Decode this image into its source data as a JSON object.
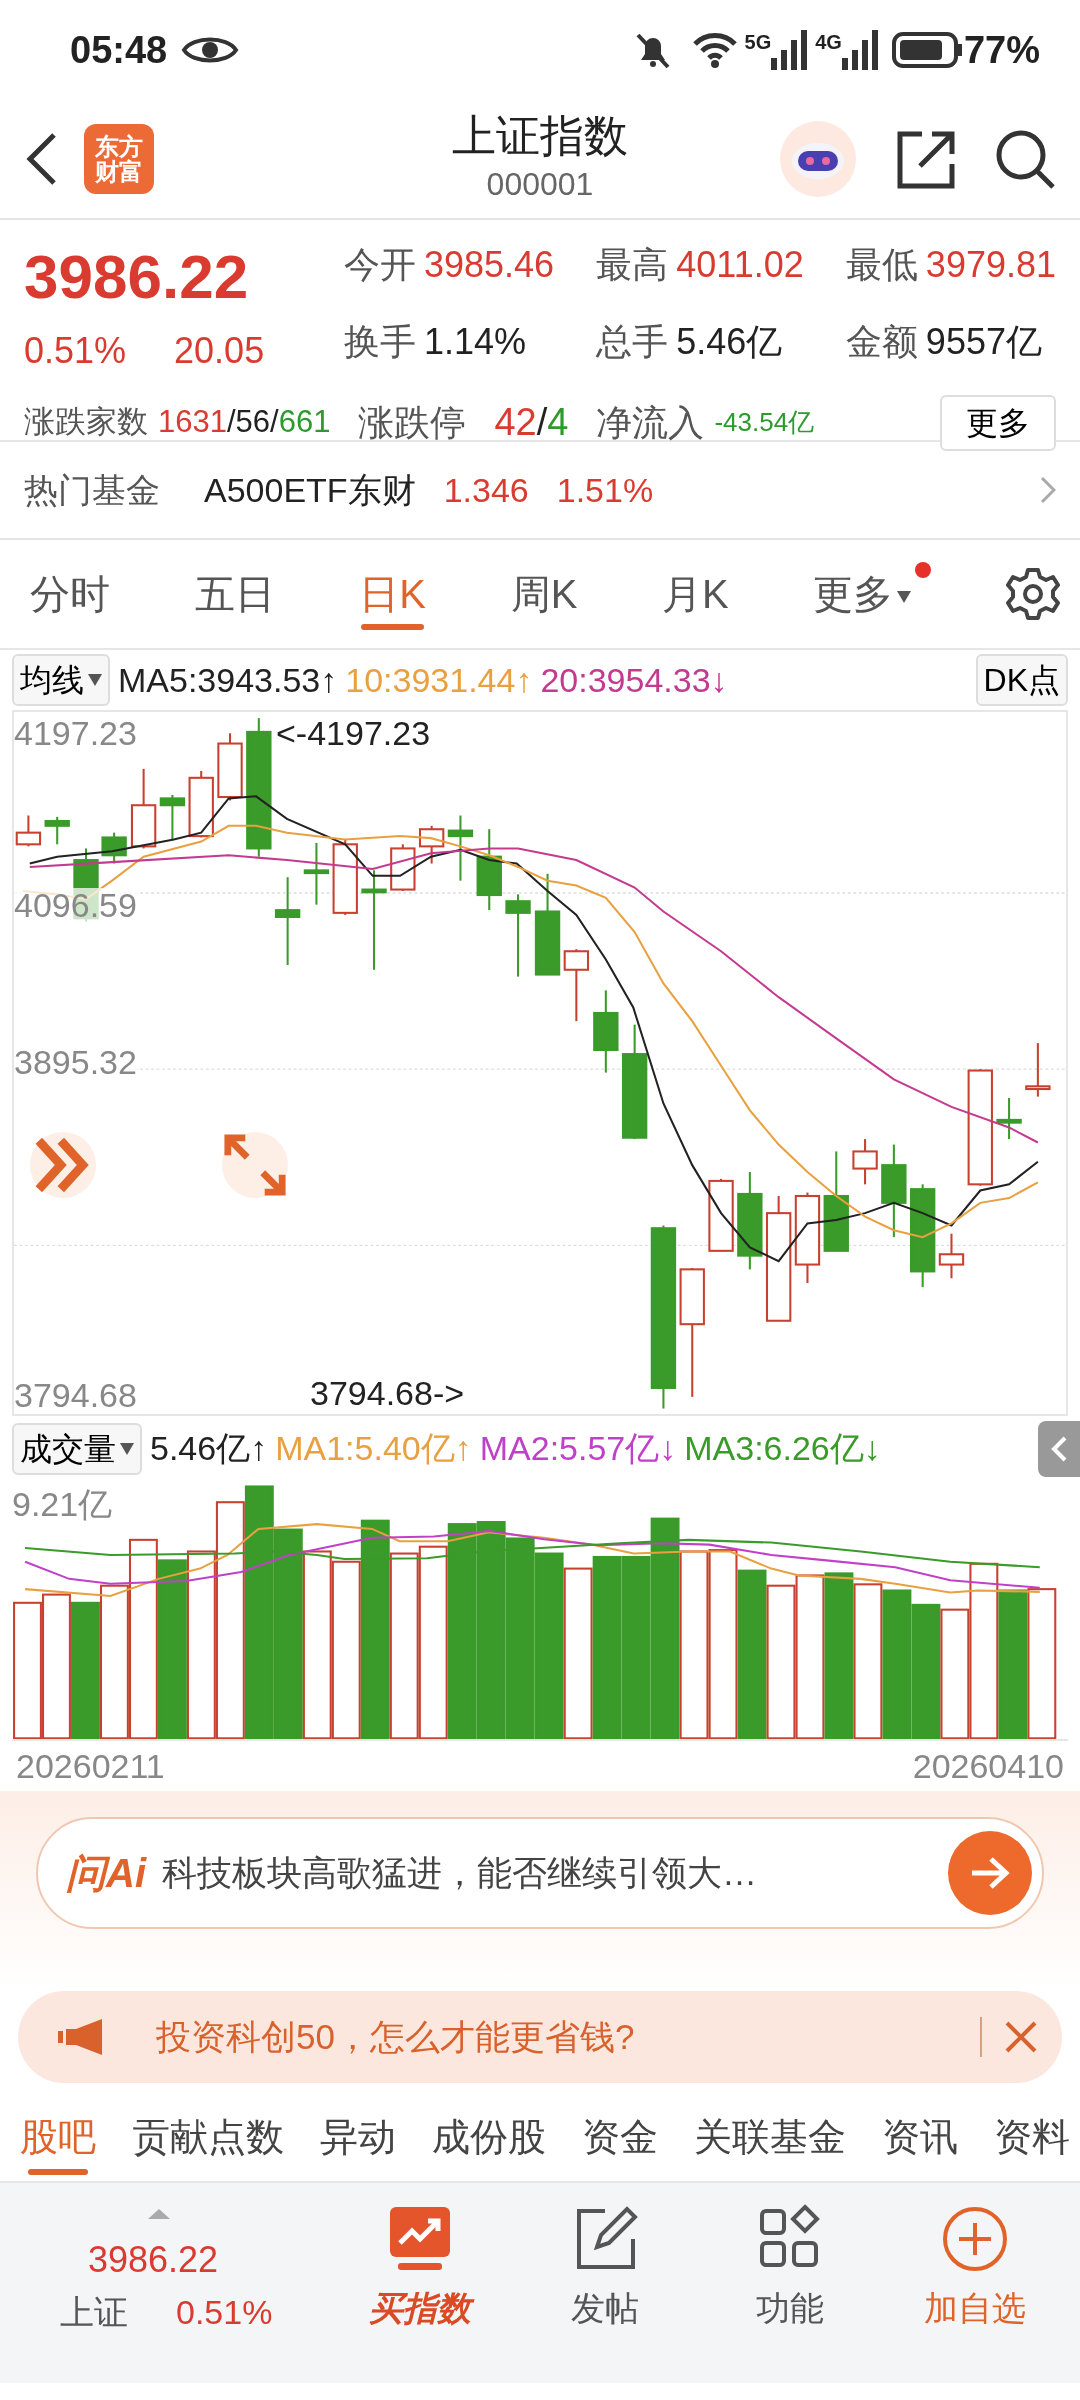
{
  "status_bar": {
    "time": "05:48",
    "network_1": "5G",
    "network_2": "4G",
    "battery": "77%"
  },
  "header": {
    "logo": [
      "东方",
      "财富"
    ],
    "title": "上证指数",
    "code": "000001"
  },
  "quote": {
    "price": "3986.22",
    "change_pct": "0.51%",
    "change": "20.05",
    "stats": [
      {
        "label": "今开",
        "value": "3985.46",
        "color": "#d93b30"
      },
      {
        "label": "最高",
        "value": "4011.02",
        "color": "#d93b30"
      },
      {
        "label": "最低",
        "value": "3979.81",
        "color": "#d93b30"
      },
      {
        "label": "换手",
        "value": "1.14%",
        "color": "#222222"
      },
      {
        "label": "总手",
        "value": "5.46亿",
        "color": "#222222"
      },
      {
        "label": "金额",
        "value": "9557亿",
        "color": "#222222"
      }
    ],
    "breadth": {
      "label": "涨跌家数",
      "up": "1631",
      "separator_1": "/",
      "flat": "56",
      "separator_2": "/",
      "down": "661"
    },
    "limit": {
      "label": "涨跌停",
      "up": "42",
      "separator": "/",
      "down": "4"
    },
    "net_inflow": {
      "label": "净流入",
      "value": "-43.54亿"
    },
    "more_button": "更多"
  },
  "hot_fund": {
    "label": "热门基金",
    "name": "A500ETF东财",
    "price": "1.346",
    "change_pct": "1.51%"
  },
  "period_tabs": [
    {
      "label": "分时",
      "selected": false,
      "dot": false
    },
    {
      "label": "五日",
      "selected": false,
      "dot": false
    },
    {
      "label": "日K",
      "selected": true,
      "dot": false
    },
    {
      "label": "周K",
      "selected": false,
      "dot": false
    },
    {
      "label": "月K",
      "selected": false,
      "dot": false
    },
    {
      "label": "更多",
      "selected": false,
      "dot": true
    }
  ],
  "ma_legend": {
    "selector": "均线",
    "items": [
      {
        "text": "MA5:3943.53↑",
        "color": "#222222"
      },
      {
        "text": "10:3931.44↑",
        "color": "#e8a040"
      },
      {
        "text": "20:3954.33↓",
        "color": "#c43a8f"
      }
    ],
    "dk_button": "DK点"
  },
  "price_chart": {
    "axis_labels": [
      "4197.23",
      "4096.59",
      "3895.32",
      "3794.68"
    ],
    "max_marker": "<-4197.23",
    "min_marker": "3794.68->"
  },
  "volume_legend": {
    "selector": "成交量",
    "items": [
      {
        "text": "5.46亿↑",
        "color": "#222222"
      },
      {
        "text": "MA1:5.40亿↑",
        "color": "#e8a040"
      },
      {
        "text": "MA2:5.57亿↓",
        "color": "#c040c8"
      },
      {
        "text": "MA3:6.26亿↓",
        "color": "#3a9a2a"
      }
    ]
  },
  "volume_chart": {
    "axis_label": "9.21亿",
    "start_date": "20260211",
    "end_date": "20260410"
  },
  "ai_bar": {
    "logo": "问Ai",
    "text": "科技板块高歌猛进，能否继续引领大…"
  },
  "banner": {
    "text": "投资科创50，怎么才能更省钱?"
  },
  "section_tabs": [
    {
      "label": "股吧",
      "selected": true
    },
    {
      "label": "贡献点数",
      "selected": false
    },
    {
      "label": "异动",
      "selected": false
    },
    {
      "label": "成份股",
      "selected": false
    },
    {
      "label": "资金",
      "selected": false
    },
    {
      "label": "关联基金",
      "selected": false
    },
    {
      "label": "资讯",
      "selected": false
    },
    {
      "label": "资料",
      "selected": false
    }
  ],
  "bottom_nav": {
    "quote": {
      "price": "3986.22",
      "name": "上证",
      "change_pct": "0.51%"
    },
    "items": [
      {
        "label": "买指数",
        "kind": "buy"
      },
      {
        "label": "发帖",
        "kind": "post"
      },
      {
        "label": "功能",
        "kind": "functions"
      },
      {
        "label": "加自选",
        "kind": "add"
      }
    ]
  }
}
